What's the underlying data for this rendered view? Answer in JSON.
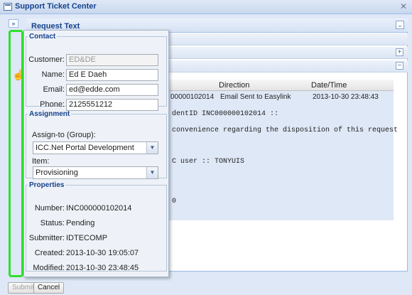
{
  "window": {
    "title": "Support Ticket Center",
    "close_glyph": "✕",
    "app_icon": "window-icon"
  },
  "footer": {
    "submit_label": "Submit",
    "cancel_label": "Cancel"
  },
  "strip": {
    "expand_glyph": "»"
  },
  "right_panel": {
    "title": "Request Text",
    "collapse_glyph": "⌄",
    "bar_plus": "+",
    "bar_minus": "−",
    "grid": {
      "columns": [
        "Direction",
        "Date/Time"
      ],
      "row": {
        "id_fragment": "00000102014",
        "direction": "Email Sent to Easylink",
        "datetime": "2013-10-30 23:48:43"
      }
    },
    "message_lines": [
      "dentID INC000000102014 ::",
      "convenience regarding the disposition of this request",
      "C user :: TONYUIS",
      "0"
    ]
  },
  "form": {
    "contact": {
      "legend": "Contact",
      "customer_label": "Customer:",
      "customer_value": "ED&DE",
      "name_label": "Name:",
      "name_value": "Ed E Daeh",
      "email_label": "Email:",
      "email_value": "ed@edde.com",
      "phone_label": "Phone:",
      "phone_value": "2125551212"
    },
    "assignment": {
      "legend": "Assignment",
      "assign_label": "Assign-to (Group):",
      "assign_value": "ICC.Net Portal Development",
      "item_label": "Item:",
      "item_value": "Provisioning",
      "arrow_glyph": "▼"
    },
    "properties": {
      "legend": "Properties",
      "number_label": "Number:",
      "number_value": "INC000000102014",
      "status_label": "Status:",
      "status_value": "Pending",
      "submitter_label": "Submitter:",
      "submitter_value": "IDTECOMP",
      "created_label": "Created:",
      "created_value": "2013-10-30 19:05:07",
      "modified_label": "Modified:",
      "modified_value": "2013-10-30 23:48:45"
    }
  },
  "colors": {
    "highlight": "#2ee02e",
    "accent": "#15428b",
    "panel_bg": "#dfe8f6"
  },
  "cursor": {
    "icon": "hand-pointer-icon",
    "glyph": "☝"
  }
}
